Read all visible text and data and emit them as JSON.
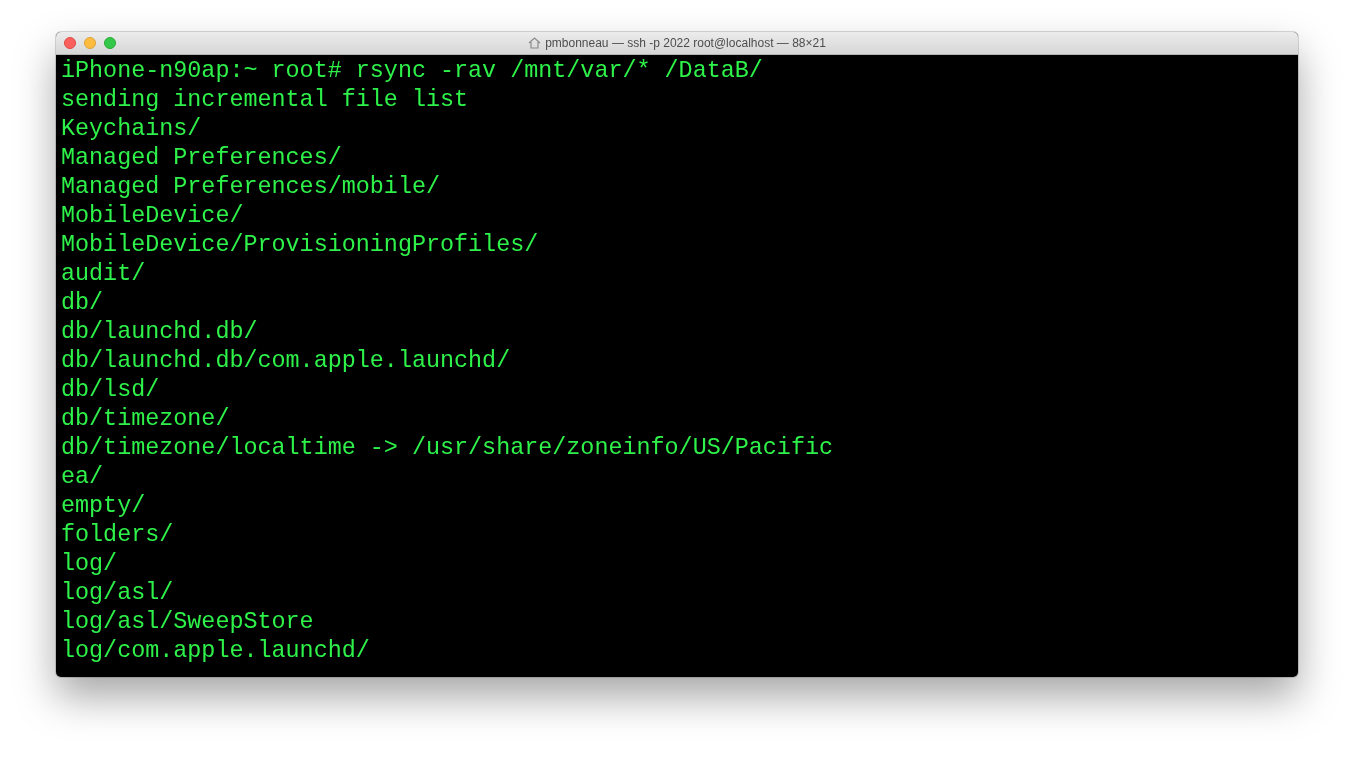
{
  "window": {
    "title": "pmbonneau — ssh -p 2022 root@localhost — 88×21"
  },
  "terminal": {
    "lines": [
      "iPhone-n90ap:~ root# rsync -rav /mnt/var/* /DataB/",
      "sending incremental file list",
      "Keychains/",
      "Managed Preferences/",
      "Managed Preferences/mobile/",
      "MobileDevice/",
      "MobileDevice/ProvisioningProfiles/",
      "audit/",
      "db/",
      "db/launchd.db/",
      "db/launchd.db/com.apple.launchd/",
      "db/lsd/",
      "db/timezone/",
      "db/timezone/localtime -> /usr/share/zoneinfo/US/Pacific",
      "ea/",
      "empty/",
      "folders/",
      "log/",
      "log/asl/",
      "log/asl/SweepStore",
      "log/com.apple.launchd/"
    ]
  }
}
